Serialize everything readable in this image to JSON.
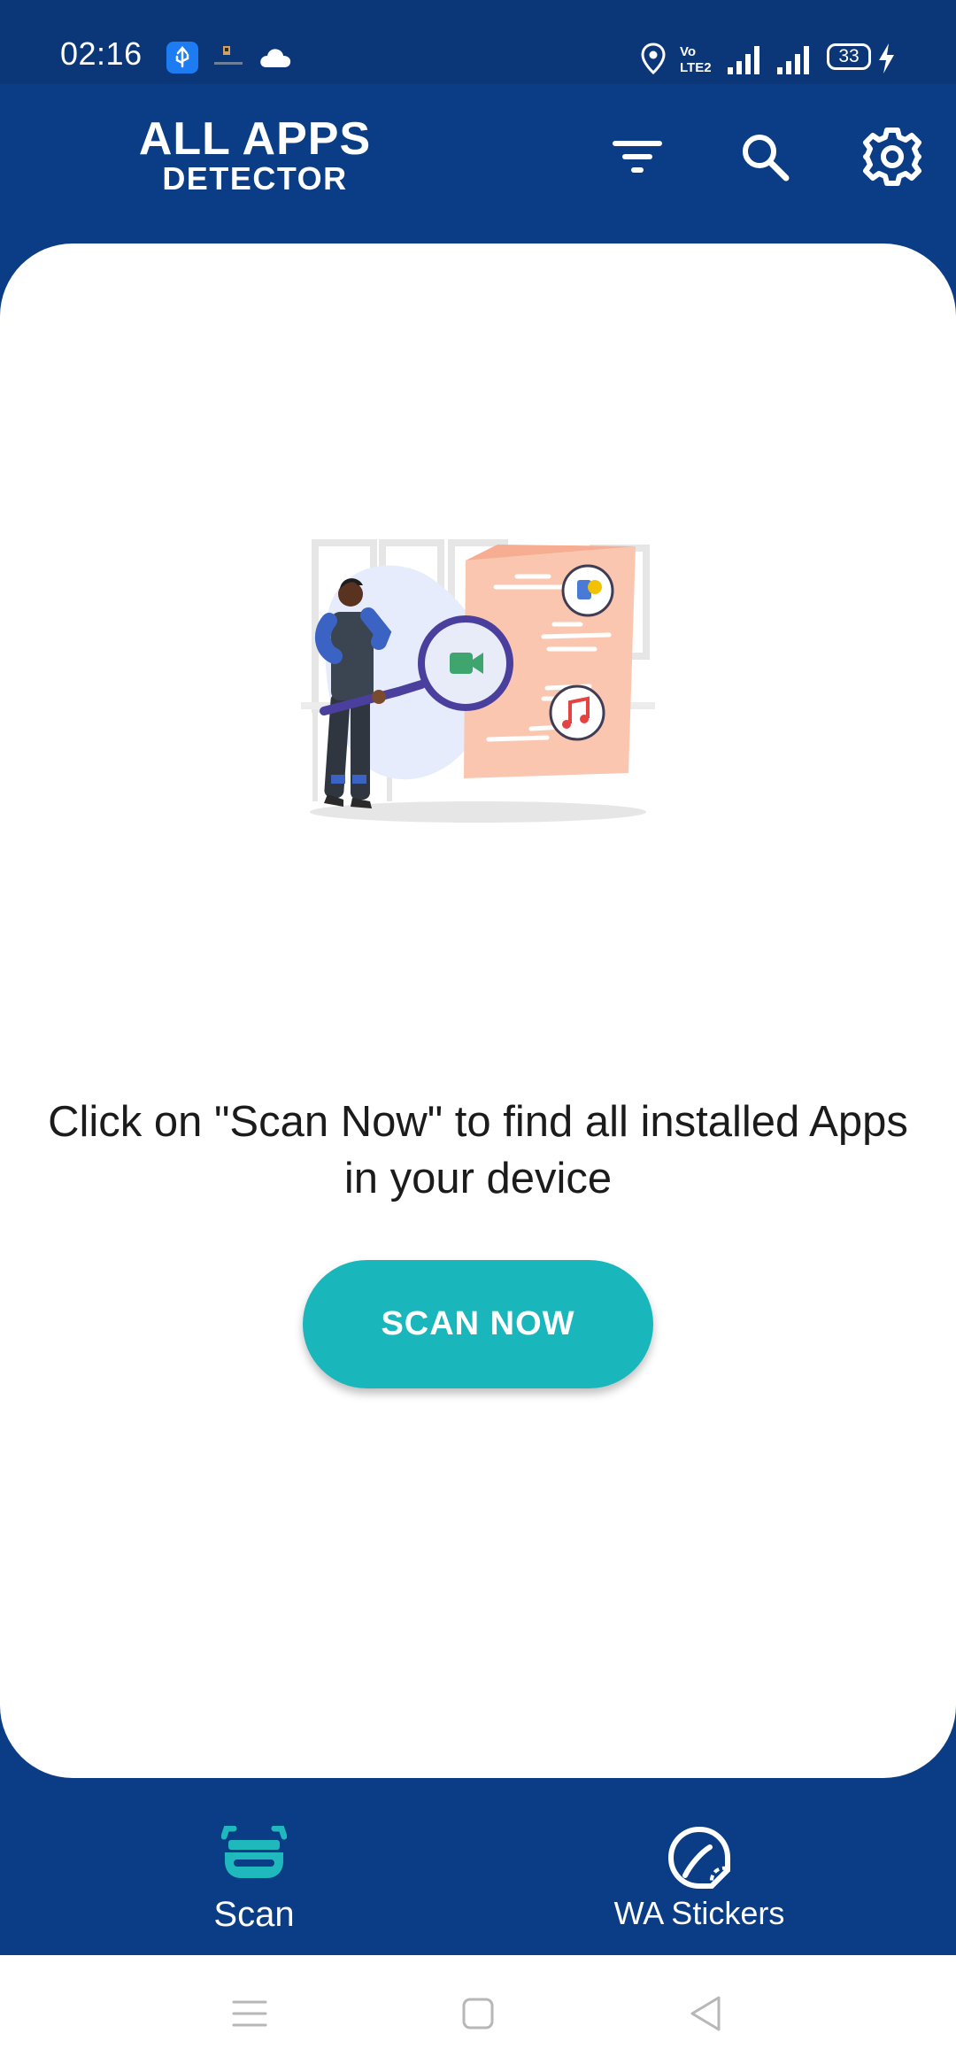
{
  "status_bar": {
    "time": "02:16",
    "battery_level": "33",
    "icons": [
      "usb-debug-icon",
      "notification-thumbnail-icon",
      "cloud-icon",
      "location-icon",
      "volte-icon",
      "signal-icon",
      "battery-icon",
      "charging-icon"
    ],
    "volte_label": "Vo LTE2"
  },
  "app_bar": {
    "logo_line1": "ALL APPS",
    "logo_line2": "DETECTOR",
    "actions": [
      "filter-icon",
      "search-icon",
      "settings-icon"
    ]
  },
  "main": {
    "prompt_text": "Click on \"Scan Now\" to find all installed Apps in your device",
    "scan_button_label": "SCAN NOW"
  },
  "bottom_nav": {
    "items": [
      {
        "label": "Scan",
        "icon": "scan-icon",
        "selected": true
      },
      {
        "label": "WA Stickers",
        "icon": "sticker-icon",
        "selected": false
      }
    ]
  },
  "system_nav": {
    "buttons": [
      "recents-icon",
      "home-icon",
      "back-icon"
    ]
  },
  "colors": {
    "primary": "#0a3d85",
    "accent": "#19b7bb",
    "surface": "#ffffff",
    "text": "#1b1b1b"
  }
}
